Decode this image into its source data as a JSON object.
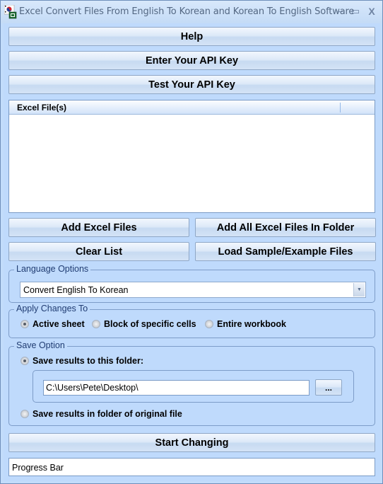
{
  "window": {
    "title": "Excel Convert Files From English To Korean and Korean To English Software",
    "minimize_glyph": "–",
    "maximize_glyph": "▭",
    "close_glyph": "X"
  },
  "buttons": {
    "help": "Help",
    "enter_api_key": "Enter Your API Key",
    "test_api_key": "Test Your API Key",
    "add_excel_files": "Add Excel Files",
    "add_all_in_folder": "Add All Excel Files In Folder",
    "clear_list": "Clear List",
    "load_sample": "Load Sample/Example Files",
    "browse": "...",
    "start": "Start Changing"
  },
  "file_list": {
    "columns": [
      "Excel File(s)",
      ""
    ],
    "rows": []
  },
  "language_options": {
    "label": "Language Options",
    "selected": "Convert English To Korean"
  },
  "apply_changes": {
    "label": "Apply Changes To",
    "options": [
      {
        "label": "Active sheet",
        "checked": true
      },
      {
        "label": "Block of specific cells",
        "checked": false
      },
      {
        "label": "Entire workbook",
        "checked": false
      }
    ]
  },
  "save_option": {
    "label": "Save Option",
    "options": [
      {
        "label": "Save results to this folder:",
        "checked": true
      },
      {
        "label": "Save results in folder of original file",
        "checked": false
      }
    ],
    "folder_path": "C:\\Users\\Pete\\Desktop\\"
  },
  "progress": {
    "label": "Progress Bar",
    "value": 0
  }
}
